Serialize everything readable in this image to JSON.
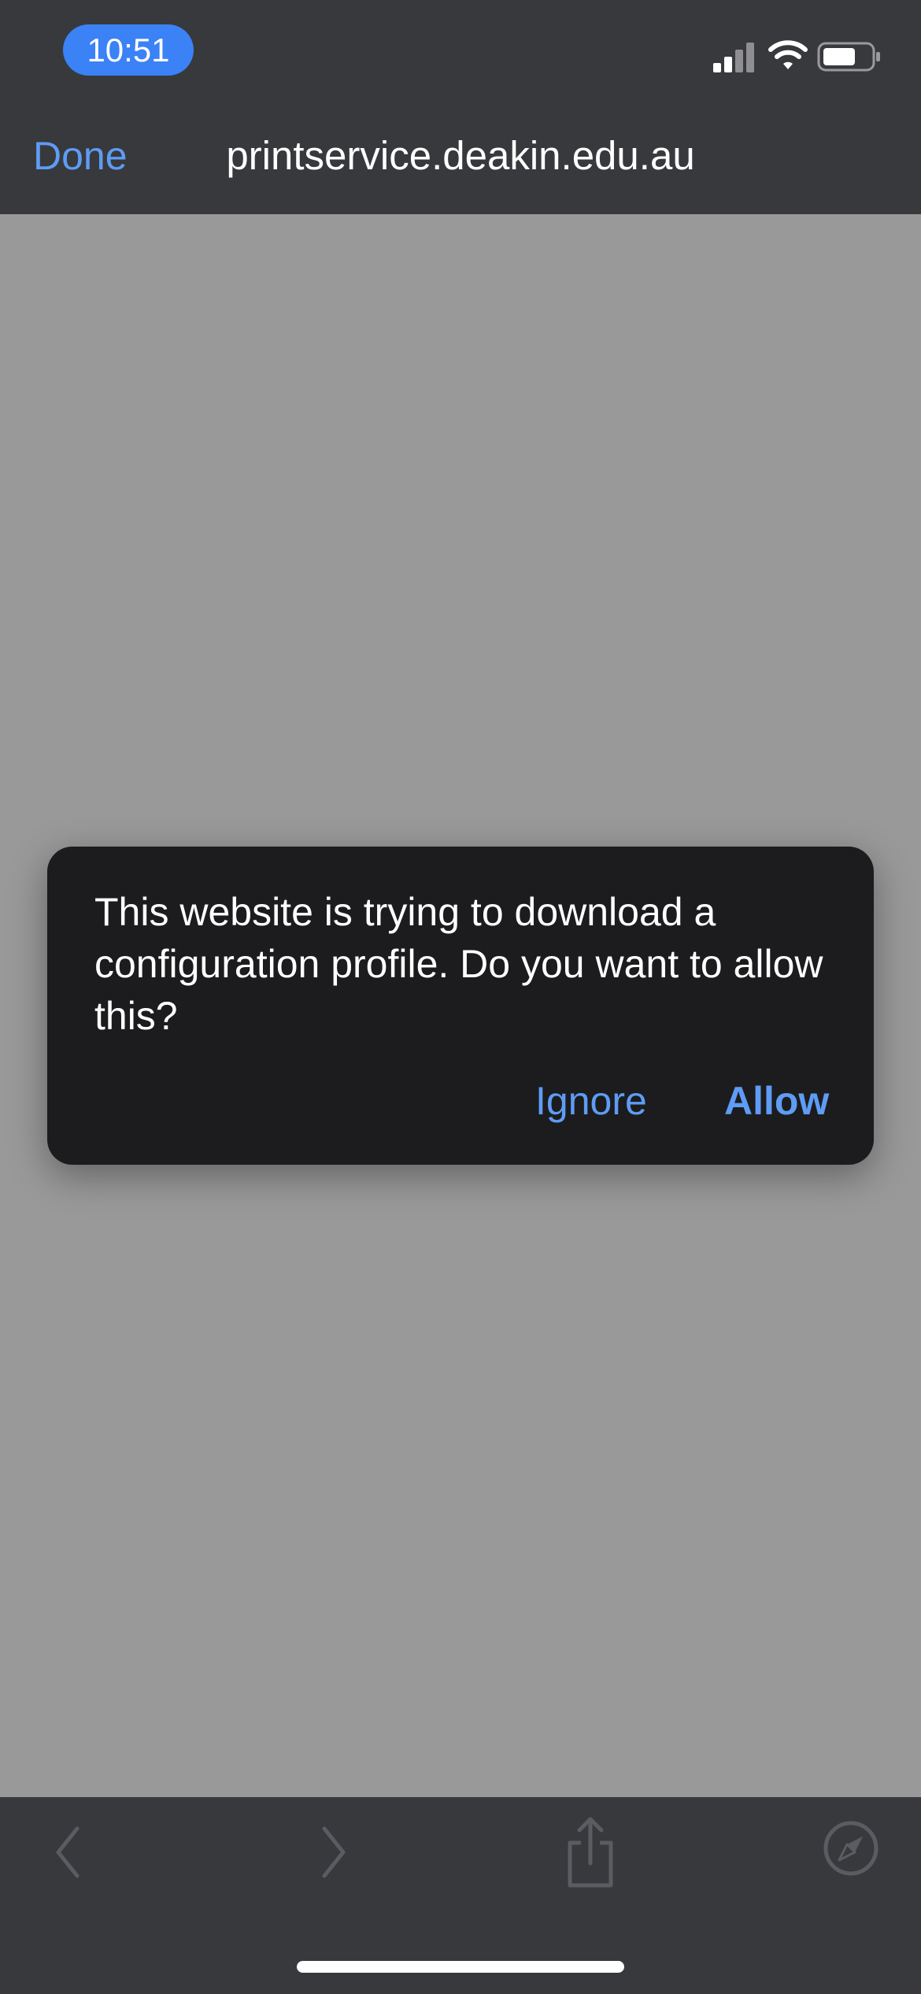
{
  "status_bar": {
    "time": "10:51"
  },
  "header": {
    "done_label": "Done",
    "url": "printservice.deakin.edu.au"
  },
  "dialog": {
    "message": "This website is trying to download a configuration profile. Do you want to allow this?",
    "ignore_label": "Ignore",
    "allow_label": "Allow"
  },
  "toolbar": {
    "icons": [
      "back-icon",
      "forward-icon",
      "share-icon",
      "compass-icon"
    ]
  },
  "colors": {
    "accent": "#5e9cf5",
    "time_pill": "#3b82f6",
    "bar_background": "#38393c",
    "content_background": "#999999",
    "dialog_background": "#1c1c1e"
  }
}
